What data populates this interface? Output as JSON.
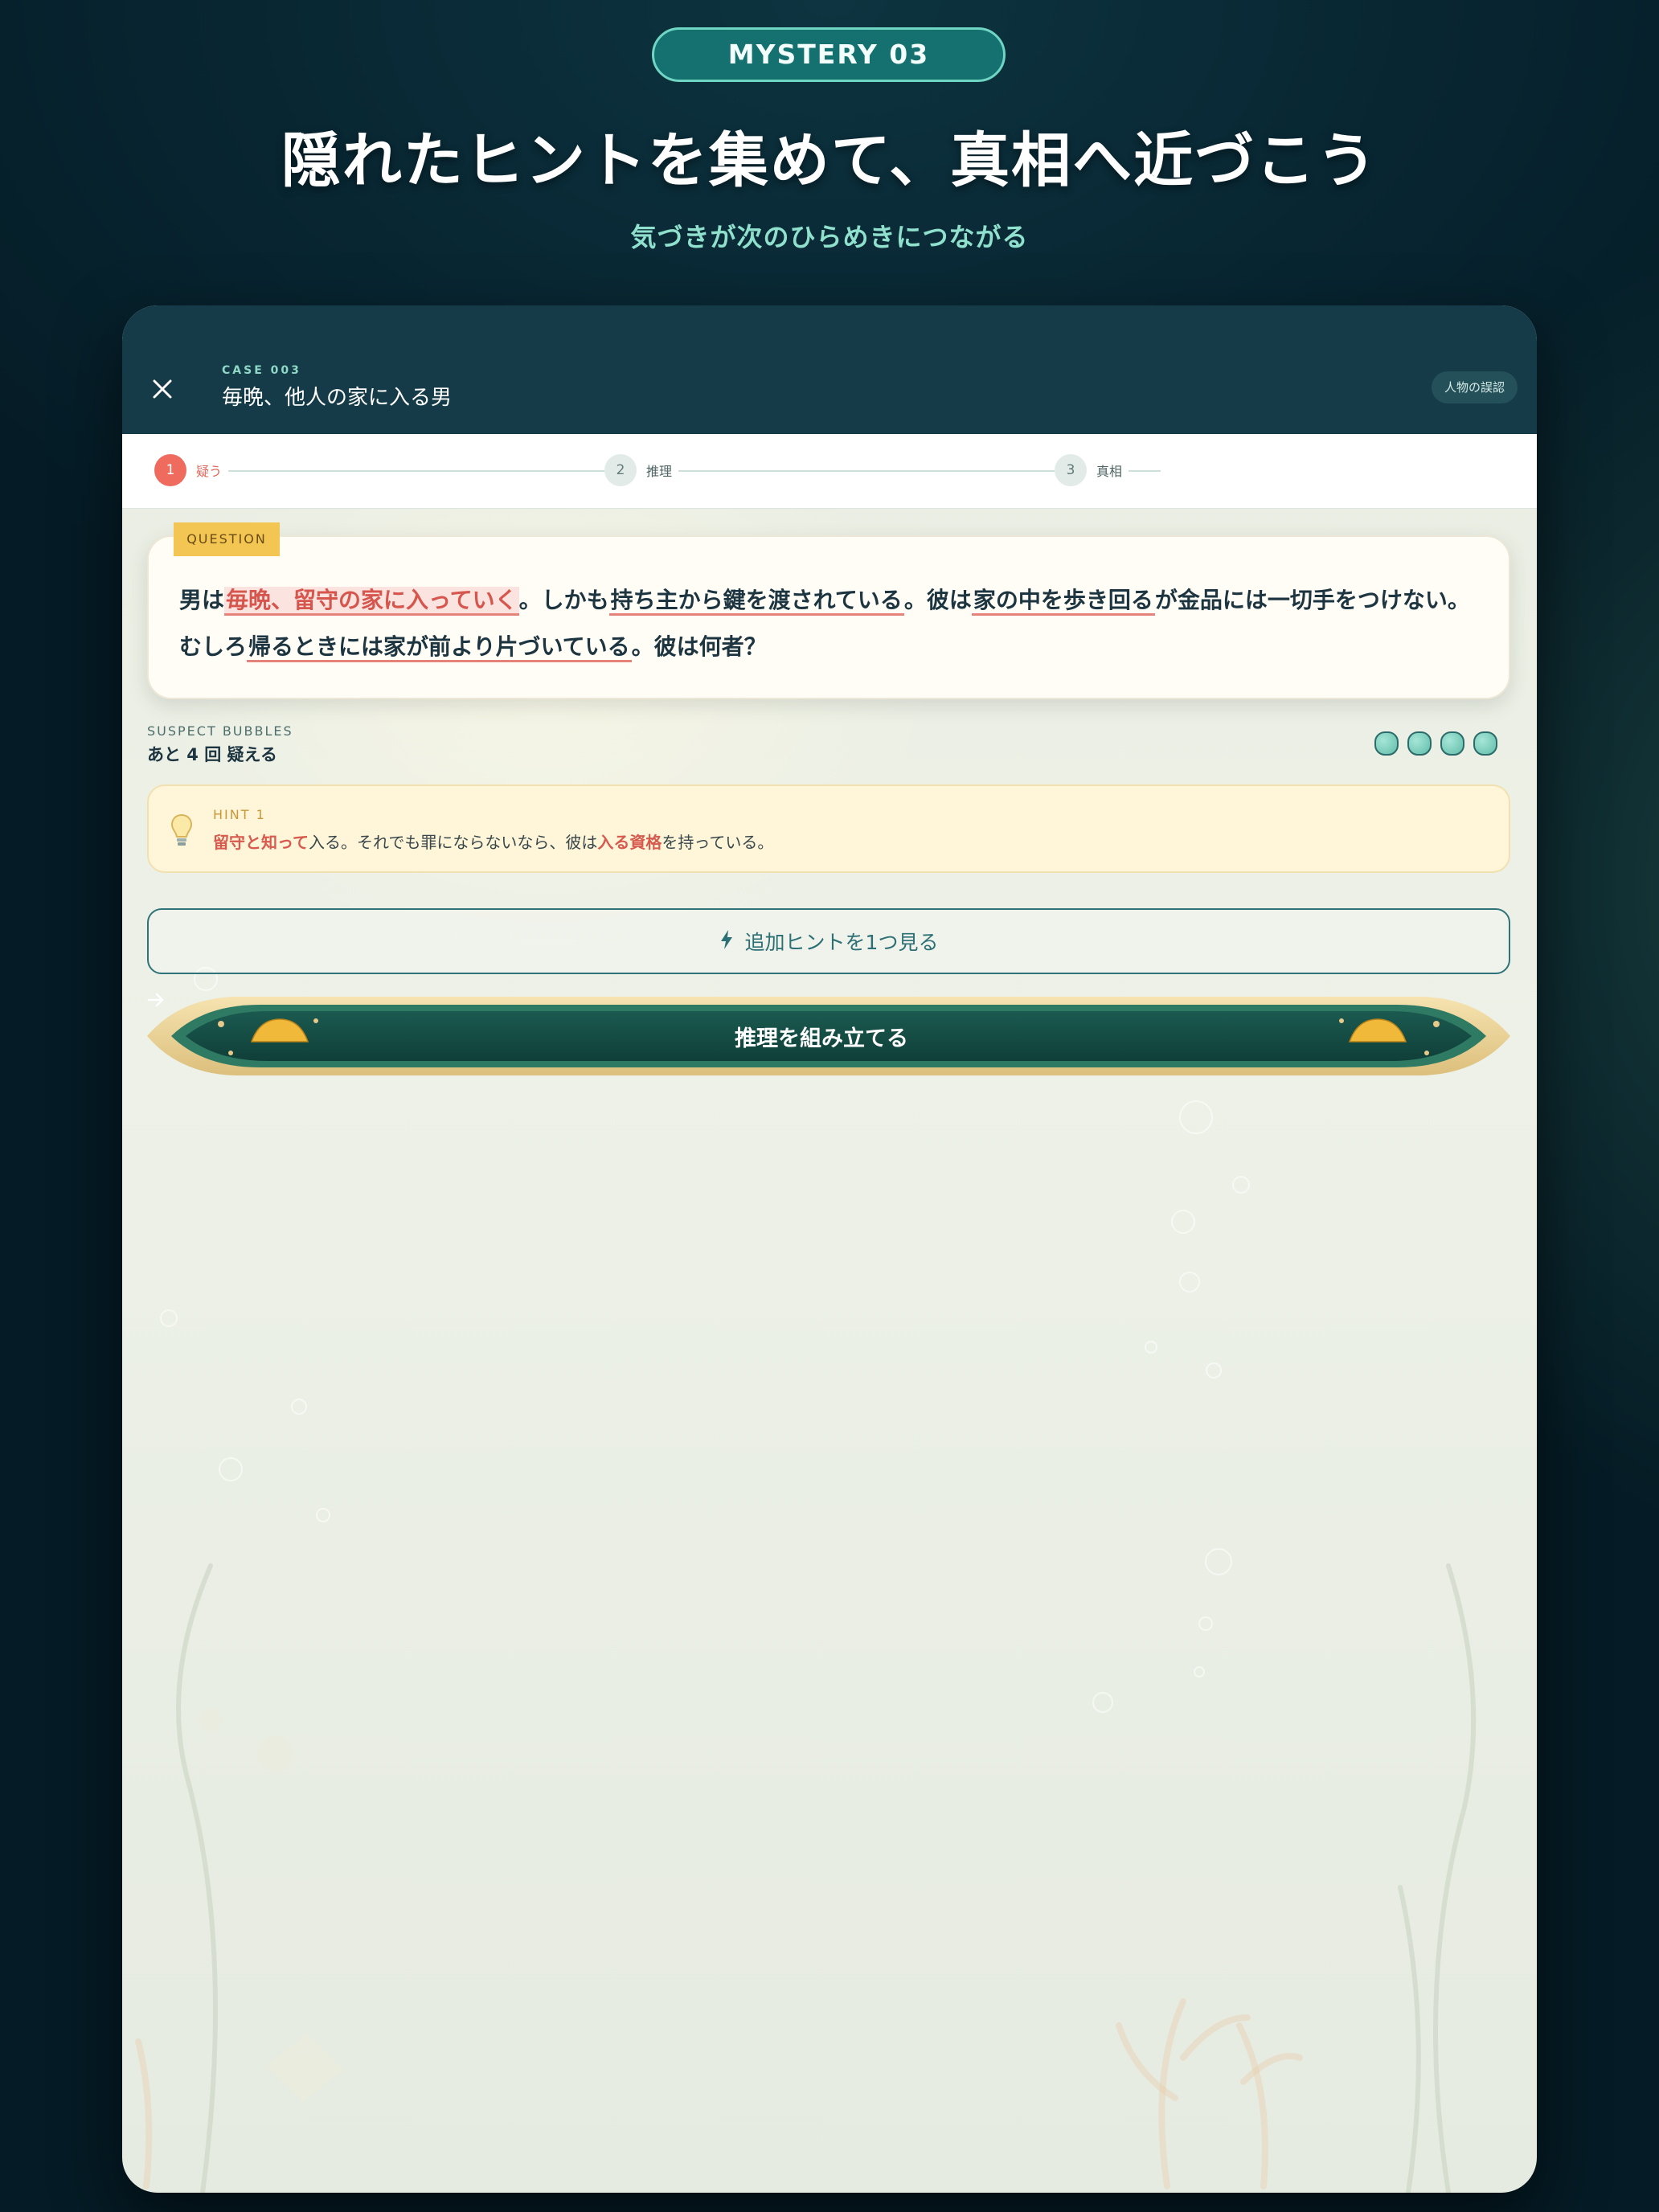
{
  "hero": {
    "badge": "MYSTERY  03",
    "headline": "隠れたヒントを集めて、真相へ近づこう",
    "subheadline": "気づきが次のひらめきにつながる"
  },
  "header": {
    "close_icon": "close-icon",
    "case_label": "CASE 003",
    "title": "毎晩、他人の家に入る男",
    "tag": "人物の誤認"
  },
  "stepper": {
    "steps": [
      {
        "num": "1",
        "label": "疑う",
        "active": true
      },
      {
        "num": "2",
        "label": "推理",
        "active": false
      },
      {
        "num": "3",
        "label": "真相",
        "active": false
      }
    ]
  },
  "question": {
    "tab": "QUESTION",
    "segments": {
      "s1": "男は",
      "h1": "毎晩、留守の家に入っていく",
      "s2": "。しかも",
      "h2": "持ち主から鍵を渡されている",
      "s3": "。彼は",
      "h3": "家の中を歩き回る",
      "s4": "が金品には一切手をつけない。",
      "s5": "むしろ",
      "h4": "帰るときには家が前より片づいている",
      "s6": "。彼は何者？"
    }
  },
  "suspect": {
    "label": "SUSPECT BUBBLES",
    "remaining_text": "あと 4 回 疑える",
    "remaining": 4
  },
  "hint": {
    "icon": "lightbulb-icon",
    "label": "HINT 1",
    "em1": "留守と知って",
    "text1": "入る。それでも罪にならないなら、彼は",
    "em2": "入る資格",
    "text2": "を持っている。"
  },
  "actions": {
    "more_hint_icon": "bolt-icon",
    "more_hint": "追加ヒントを1つ見る",
    "build": "推理を組み立てる",
    "build_icon": "arrow-right-icon"
  },
  "colors": {
    "accent": "#ef6b5e",
    "teal": "#153b48",
    "hint_bg": "#fff5d8",
    "button_green": "#144d45"
  }
}
